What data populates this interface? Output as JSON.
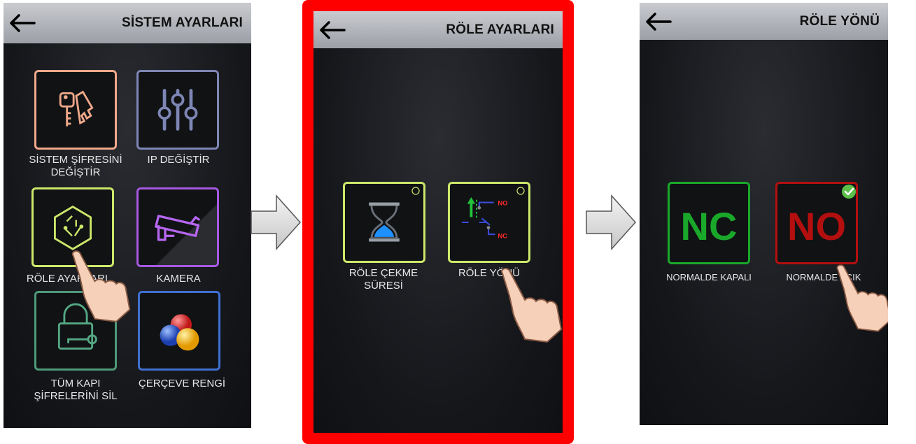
{
  "screen1": {
    "title": "SİSTEM AYARLARI",
    "items": [
      {
        "label": "SİSTEM ŞİFRESİNİ\nDEĞİŞTİR",
        "icon": "keys-icon",
        "color": "#f0a88a"
      },
      {
        "label": "IP DEĞİŞTİR",
        "icon": "sliders-icon",
        "color": "#7d86b4"
      },
      {
        "label": "RÖLE AYARLARI",
        "icon": "relay-circuit-icon",
        "color": "#cde86a"
      },
      {
        "label": "KAMERA",
        "icon": "camera-icon",
        "color": "#a659e0"
      },
      {
        "label": "TÜM KAPI\nŞİFRELERİNİ SİL",
        "icon": "padlock-key-icon",
        "color": "#4e9a7a"
      },
      {
        "label": "ÇERÇEVE RENGİ",
        "icon": "color-balls-icon",
        "color": "#3f6fd0"
      }
    ]
  },
  "screen2": {
    "title": "RÖLE AYARLARI",
    "items": [
      {
        "label": "RÖLE ÇEKME\nSÜRESİ",
        "icon": "hourglass-icon",
        "color": "#cde86a"
      },
      {
        "label": "RÖLE YÖNÜ",
        "icon": "relay-direction-icon",
        "color": "#cde86a",
        "no_text": "NO",
        "nc_text": "NC"
      }
    ]
  },
  "screen3": {
    "title": "RÖLE YÖNÜ",
    "items": [
      {
        "big": "NC",
        "label": "NORMALDE KAPALI",
        "color": "#1aa82a",
        "selected": false
      },
      {
        "big": "NO",
        "label": "NORMALDE AÇIK",
        "color": "#b40f0f",
        "selected": true
      }
    ]
  },
  "colors": {
    "highlight_frame": "#ff0000",
    "topbar": "#b3b6bc",
    "screen_bg": "#15171b"
  }
}
